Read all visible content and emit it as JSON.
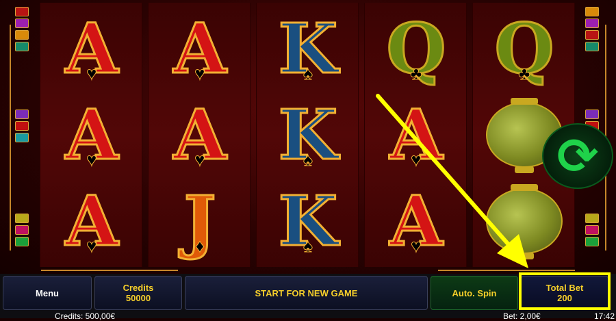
{
  "reels": [
    [
      {
        "letter": "A",
        "suit": "♥",
        "color": "red"
      },
      {
        "letter": "A",
        "suit": "♥",
        "color": "red"
      },
      {
        "letter": "A",
        "suit": "♥",
        "color": "red"
      }
    ],
    [
      {
        "letter": "A",
        "suit": "♥",
        "color": "red"
      },
      {
        "letter": "A",
        "suit": "♥",
        "color": "red"
      },
      {
        "letter": "J",
        "suit": "♦",
        "color": "orange"
      }
    ],
    [
      {
        "letter": "K",
        "suit": "♠",
        "color": "blue"
      },
      {
        "letter": "K",
        "suit": "♠",
        "color": "blue"
      },
      {
        "letter": "K",
        "suit": "♠",
        "color": "blue"
      }
    ],
    [
      {
        "letter": "Q",
        "suit": "♣",
        "color": "green"
      },
      {
        "letter": "A",
        "suit": "♥",
        "color": "red"
      },
      {
        "letter": "A",
        "suit": "♥",
        "color": "red"
      }
    ],
    [
      {
        "letter": "Q",
        "suit": "♣",
        "color": "green"
      },
      {
        "symbol": "lantern-icon"
      },
      {
        "symbol": "lantern-icon"
      }
    ]
  ],
  "refresh_icon": "refresh-icon",
  "controls": {
    "menu_label": "Menu",
    "credits_label": "Credits",
    "credits_value": "50000",
    "start_label": "START FOR NEW GAME",
    "auto_spin_label": "Auto. Spin",
    "total_bet_label": "Total Bet",
    "total_bet_value": "200"
  },
  "info": {
    "credits_text": "Credits: 500,00€",
    "bet_text": "Bet: 2,00€",
    "time_text": "17:42"
  },
  "colors": {
    "highlight": "#ffff00",
    "button_text": "#f6cf2a",
    "auto_spin_bg": "#0d3a15"
  }
}
